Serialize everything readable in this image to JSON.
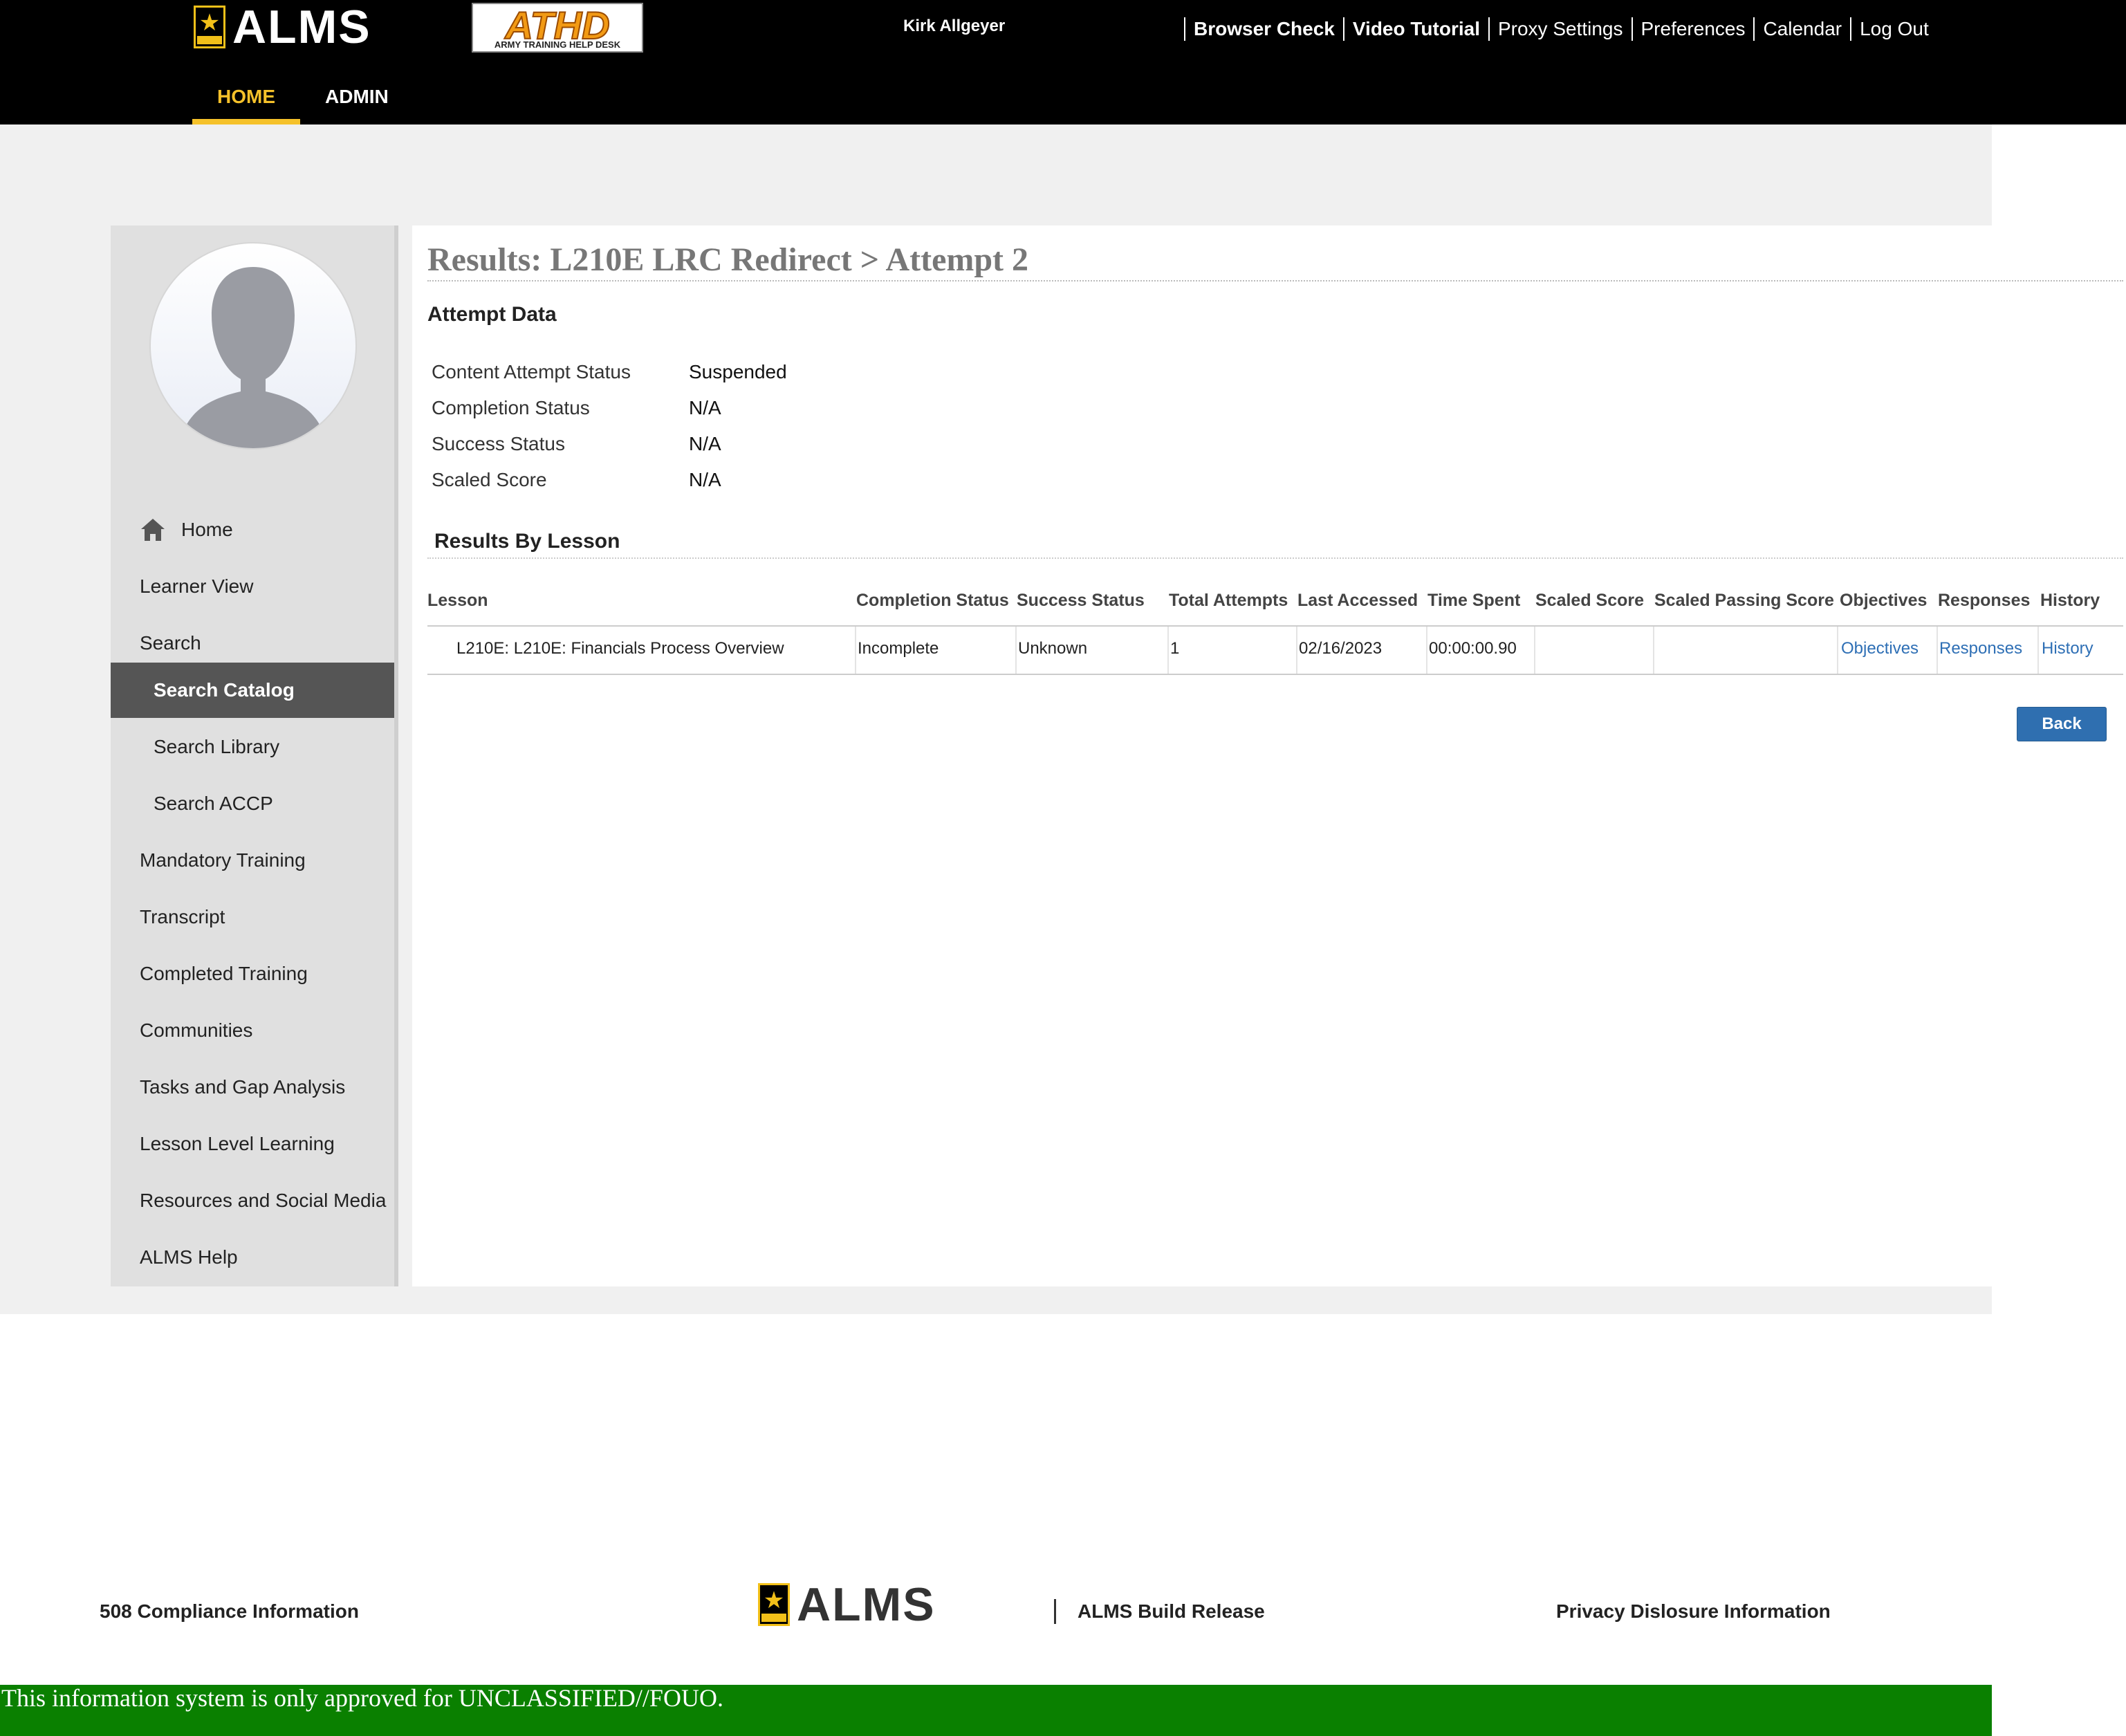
{
  "header": {
    "logo_text": "ALMS",
    "helpdesk_logo_text": "ATHD",
    "helpdesk_logo_subtext": "ARMY TRAINING HELP DESK",
    "user_name": "Kirk Allgeyer",
    "links": [
      "Browser Check",
      "Video Tutorial",
      "Proxy Settings",
      "Preferences",
      "Calendar",
      "Log Out"
    ],
    "nav_tabs": [
      "HOME",
      "ADMIN"
    ],
    "active_tab": "HOME",
    "accent_color": "#f5c12a"
  },
  "sidebar": {
    "items": [
      {
        "label": "Home",
        "icon": "home-icon"
      },
      {
        "label": "Learner View"
      },
      {
        "label": "Search"
      },
      {
        "label": "Search Catalog",
        "active": true
      },
      {
        "label": "Search Library"
      },
      {
        "label": "Search ACCP"
      },
      {
        "label": "Mandatory Training"
      },
      {
        "label": "Transcript"
      },
      {
        "label": "Completed Training"
      },
      {
        "label": "Communities"
      },
      {
        "label": "Tasks and Gap Analysis"
      },
      {
        "label": "Lesson Level Learning"
      },
      {
        "label": "Resources and Social Media"
      },
      {
        "label": "ALMS Help"
      }
    ]
  },
  "main": {
    "title": "Results: L210E LRC Redirect > Attempt 2",
    "attempt_data_heading": "Attempt Data",
    "attempt_data": [
      {
        "label": "Content Attempt Status",
        "value": "Suspended"
      },
      {
        "label": "Completion Status",
        "value": "N/A"
      },
      {
        "label": "Success Status",
        "value": "N/A"
      },
      {
        "label": "Scaled Score",
        "value": "N/A"
      }
    ],
    "results_heading": "Results By Lesson",
    "table": {
      "columns": [
        "Lesson",
        "Completion Status",
        "Success Status",
        "Total Attempts",
        "Last Accessed",
        "Time Spent",
        "Scaled Score",
        "Scaled Passing Score",
        "Objectives",
        "Responses",
        "History"
      ],
      "rows": [
        {
          "lesson": "L210E: L210E: Financials Process Overview",
          "completion_status": "Incomplete",
          "success_status": "Unknown",
          "total_attempts": "1",
          "last_accessed": "02/16/2023",
          "time_spent": "00:00:00.90",
          "scaled_score": "",
          "scaled_passing_score": "",
          "objectives": "Objectives",
          "responses": "Responses",
          "history": "History"
        }
      ]
    },
    "back_label": "Back",
    "link_color": "#2e6fb5",
    "button_color": "#2f6fb0"
  },
  "footer": {
    "compliance_link": "508 Compliance Information",
    "logo_text": "ALMS",
    "build_release": "ALMS Build Release",
    "privacy_link": "Privacy Dislosure Information",
    "classification": "This information system is only approved for UNCLASSIFIED//FOUO.",
    "classification_color": "#0a8000"
  }
}
